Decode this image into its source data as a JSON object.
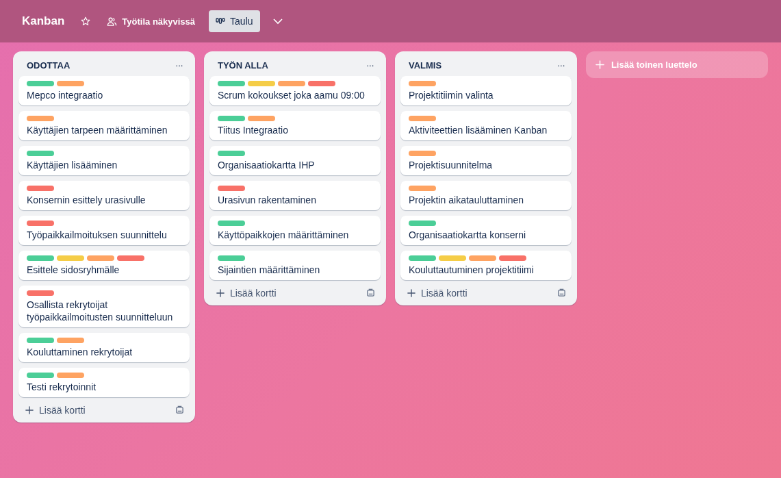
{
  "board": {
    "title": "Kanban",
    "visibility": "Työtila näkyvissä",
    "view": "Taulu"
  },
  "lists": [
    {
      "title": "ODOTTAA",
      "menu": "···",
      "add_card": "Lisää kortti",
      "cards": [
        {
          "title": "Mepco integraatio",
          "labels": [
            {
              "color": "#4bce97"
            },
            {
              "color": "#fea362"
            }
          ]
        },
        {
          "title": "Käyttäjien tarpeen määrittäminen",
          "labels": [
            {
              "color": "#fea362"
            }
          ]
        },
        {
          "title": "Käyttäjien lisääminen",
          "labels": [
            {
              "color": "#4bce97"
            }
          ]
        },
        {
          "title": "Konsernin esittely urasivulle",
          "labels": [
            {
              "color": "#f87168"
            }
          ]
        },
        {
          "title": "Työpaikkailmoituksen suunnittelu",
          "labels": [
            {
              "color": "#f87168"
            }
          ]
        },
        {
          "title": "Esittele sidosryhmälle",
          "labels": [
            {
              "color": "#4bce97"
            },
            {
              "color": "#f5cd47"
            },
            {
              "color": "#fea362"
            },
            {
              "color": "#f87168"
            }
          ]
        },
        {
          "title": "Osallista rekrytoijat työpaikkailmoitusten suunnitteluun",
          "labels": [
            {
              "color": "#f87168"
            }
          ]
        },
        {
          "title": "Kouluttaminen rekrytoijat",
          "labels": [
            {
              "color": "#4bce97"
            },
            {
              "color": "#fea362"
            }
          ]
        },
        {
          "title": "Testi rekrytoinnit",
          "labels": [
            {
              "color": "#4bce97"
            },
            {
              "color": "#fea362"
            }
          ]
        }
      ]
    },
    {
      "title": "TYÖN ALLA",
      "menu": "···",
      "add_card": "Lisää kortti",
      "cards": [
        {
          "title": "Scrum kokoukset joka aamu 09:00",
          "labels": [
            {
              "color": "#4bce97"
            },
            {
              "color": "#f5cd47"
            },
            {
              "color": "#fea362"
            },
            {
              "color": "#f87168"
            }
          ]
        },
        {
          "title": "Tiitus Integraatio",
          "labels": [
            {
              "color": "#4bce97"
            },
            {
              "color": "#fea362"
            }
          ]
        },
        {
          "title": "Organisaatiokartta IHP",
          "labels": [
            {
              "color": "#4bce97"
            }
          ]
        },
        {
          "title": "Urasivun rakentaminen",
          "labels": [
            {
              "color": "#f87168"
            }
          ]
        },
        {
          "title": "Käyttöpaikkojen määrittäminen",
          "labels": [
            {
              "color": "#4bce97"
            }
          ]
        },
        {
          "title": "Sijaintien määrittäminen",
          "labels": [
            {
              "color": "#4bce97"
            }
          ]
        }
      ]
    },
    {
      "title": "VALMIS",
      "menu": "···",
      "add_card": "Lisää kortti",
      "cards": [
        {
          "title": "Projektitiimin valinta",
          "labels": [
            {
              "color": "#fea362"
            }
          ]
        },
        {
          "title": "Aktiviteettien lisääminen Kanban",
          "labels": [
            {
              "color": "#fea362"
            }
          ]
        },
        {
          "title": "Projektisuunnitelma",
          "labels": [
            {
              "color": "#fea362"
            }
          ]
        },
        {
          "title": "Projektin aikatauluttaminen",
          "labels": [
            {
              "color": "#fea362"
            }
          ]
        },
        {
          "title": "Organisaatiokartta konserni",
          "labels": [
            {
              "color": "#4bce97"
            }
          ]
        },
        {
          "title": "Kouluttautuminen projektitiimi",
          "labels": [
            {
              "color": "#4bce97"
            },
            {
              "color": "#f5cd47"
            },
            {
              "color": "#fea362"
            },
            {
              "color": "#f87168"
            }
          ]
        }
      ]
    }
  ],
  "add_list": "Lisää toinen luettelo"
}
